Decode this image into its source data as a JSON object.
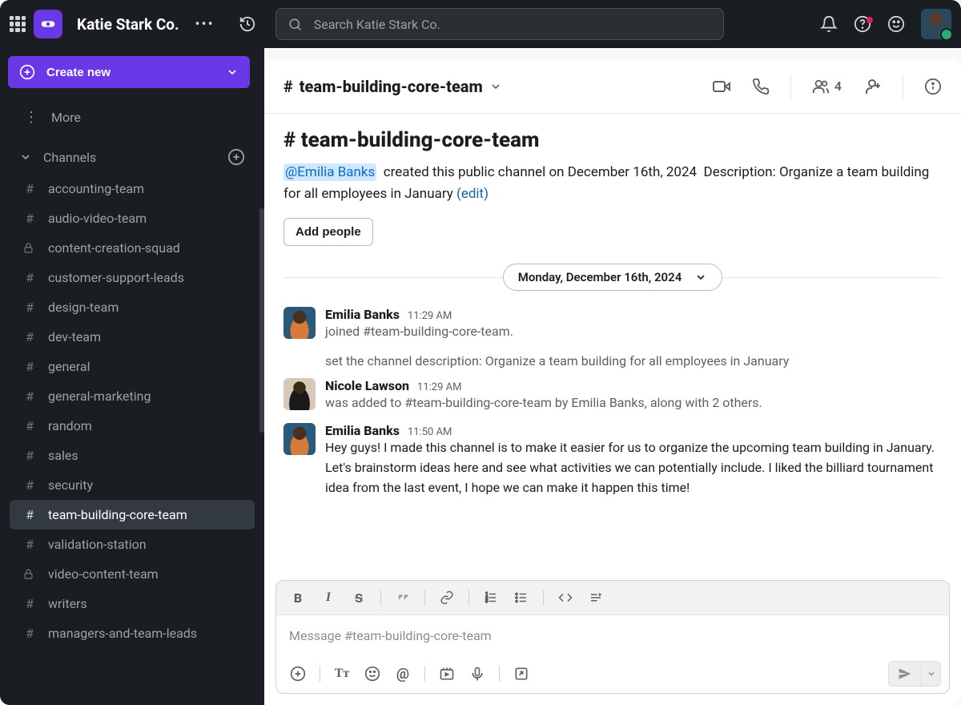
{
  "workspace": {
    "name": "Katie Stark Co."
  },
  "search": {
    "placeholder": "Search Katie Stark Co."
  },
  "sidebar": {
    "create_label": "Create new",
    "more_label": "More",
    "channels_label": "Channels",
    "channels": [
      {
        "name": "accounting-team",
        "icon": "hash",
        "active": false
      },
      {
        "name": "audio-video-team",
        "icon": "hash",
        "active": false
      },
      {
        "name": "content-creation-squad",
        "icon": "lock",
        "active": false
      },
      {
        "name": "customer-support-leads",
        "icon": "hash",
        "active": false
      },
      {
        "name": "design-team",
        "icon": "hash",
        "active": false
      },
      {
        "name": "dev-team",
        "icon": "hash",
        "active": false
      },
      {
        "name": "general",
        "icon": "hash",
        "active": false
      },
      {
        "name": "general-marketing",
        "icon": "hash",
        "active": false
      },
      {
        "name": "random",
        "icon": "hash",
        "active": false
      },
      {
        "name": "sales",
        "icon": "hash",
        "active": false
      },
      {
        "name": "security",
        "icon": "hash",
        "active": false
      },
      {
        "name": "team-building-core-team",
        "icon": "hash",
        "active": true
      },
      {
        "name": "validation-station",
        "icon": "hash",
        "active": false
      },
      {
        "name": "video-content-team",
        "icon": "lock",
        "active": false
      },
      {
        "name": "writers",
        "icon": "hash",
        "active": false
      },
      {
        "name": "managers-and-team-leads",
        "icon": "hash",
        "active": false
      }
    ]
  },
  "channel": {
    "name": "team-building-core-team",
    "member_count": "4",
    "intro": {
      "creator": "@Emilia Banks",
      "created_text": "created this public channel on December 16th, 2024",
      "description_label": "Description:",
      "description": "Organize a team building for all employees in January",
      "edit": "(edit)",
      "add_people": "Add people"
    },
    "date_separator": "Monday, December 16th, 2024",
    "messages": [
      {
        "author": "Emilia Banks",
        "time": "11:29 AM",
        "avatar": "av1",
        "line1": "joined #team-building-core-team.",
        "line2": "set the channel description: Organize a team building for all employees in January"
      },
      {
        "author": "Nicole Lawson",
        "time": "11:29 AM",
        "avatar": "av2",
        "line1": "was added to #team-building-core-team by Emilia Banks, along with 2 others."
      },
      {
        "author": "Emilia Banks",
        "time": "11:50 AM",
        "avatar": "av1",
        "body": "Hey guys! I made this channel is to make it easier for us to organize the upcoming team building in January. Let's brainstorm ideas here and see what activities we can potentially include. I liked the billiard tournament idea from the last event, I hope we can make it happen this time!"
      }
    ]
  },
  "composer": {
    "placeholder": "Message #team-building-core-team"
  }
}
